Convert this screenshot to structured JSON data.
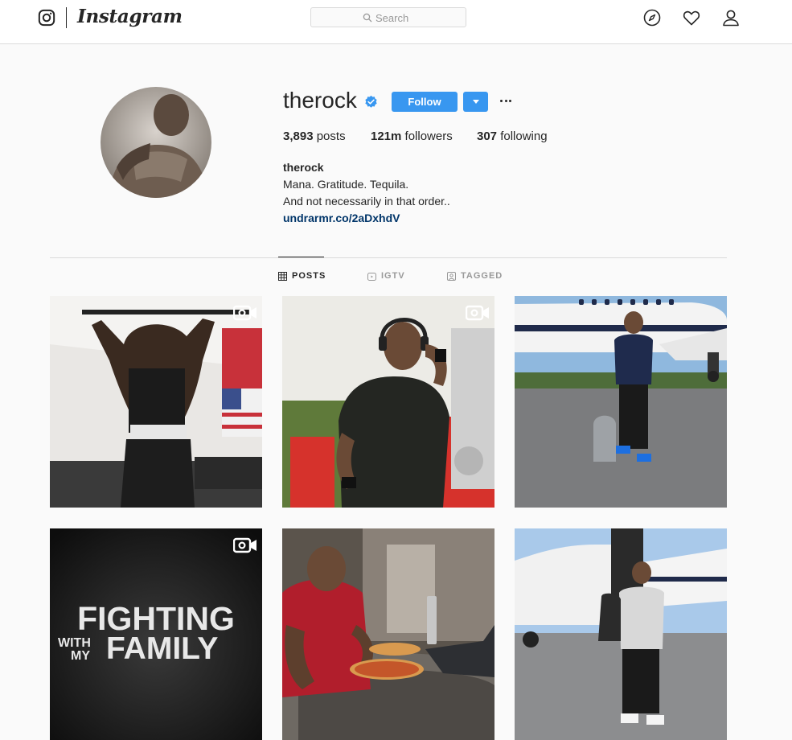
{
  "nav": {
    "wordmark": "Instagram",
    "search_placeholder": "Search",
    "icons": [
      "camera-icon",
      "search-icon",
      "compass-icon",
      "heart-icon",
      "profile-icon"
    ]
  },
  "profile": {
    "username": "therock",
    "verified": true,
    "follow_label": "Follow",
    "stats": {
      "posts_count": "3,893",
      "posts_label": " posts",
      "followers_count": "121m",
      "followers_label": " followers",
      "following_count": "307",
      "following_label": " following"
    },
    "bio": {
      "name": "therock",
      "line1": "Mana. Gratitude. Tequila.",
      "line2": "And not necessarily in that order..",
      "link": "undrarmr.co/2aDxhdV"
    }
  },
  "tabs": [
    {
      "label": "POSTS",
      "active": true
    },
    {
      "label": "IGTV",
      "active": false
    },
    {
      "label": "TAGGED",
      "active": false
    }
  ],
  "posts": [
    {
      "type": "video",
      "alt": "gym pull-ups"
    },
    {
      "type": "video",
      "alt": "gym with headphones"
    },
    {
      "type": "photo",
      "alt": "standing by jet"
    },
    {
      "type": "video",
      "alt": "Fighting with my Family",
      "overlay_line1": "FIGHTING",
      "overlay_with": "WITH",
      "overlay_my": "MY",
      "overlay_family": "FAMILY"
    },
    {
      "type": "photo",
      "alt": "eating pizza"
    },
    {
      "type": "photo",
      "alt": "jet stairs"
    }
  ],
  "colors": {
    "accent": "#3897f0",
    "link": "#003569",
    "border": "#dbdbdb",
    "background": "#fafafa"
  }
}
